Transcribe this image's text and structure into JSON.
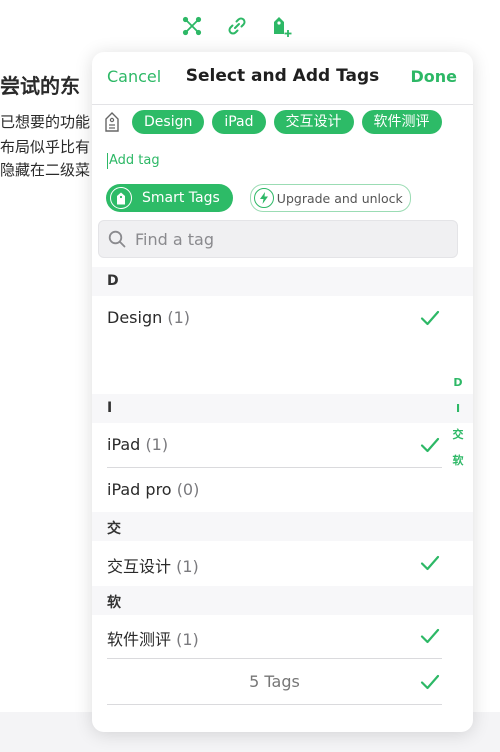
{
  "background_doc": {
    "heading": "尝试的东",
    "lines": [
      "已想要的功能",
      "布局似乎比有",
      "隐藏在二级菜"
    ]
  },
  "toolbar": {
    "icons": [
      "graph-icon",
      "link-icon",
      "add-tag-icon"
    ]
  },
  "header": {
    "cancel_label": "Cancel",
    "title": "Select and Add Tags",
    "done_label": "Done"
  },
  "selected_tags": [
    "Design",
    "iPad",
    "交互设计",
    "软件测评"
  ],
  "add_tag_placeholder": "Add tag",
  "smart_tags_label": "Smart Tags",
  "upgrade_label": "Upgrade and unlock",
  "search": {
    "placeholder": "Find a tag"
  },
  "sections": [
    {
      "letter": "D",
      "rows": [
        {
          "name": "Design",
          "count": "(1)",
          "checked": true
        }
      ]
    },
    {
      "letter": "I",
      "rows": [
        {
          "name": "iPad",
          "count": "(1)",
          "checked": true
        },
        {
          "name": "iPad pro",
          "count": "(0)",
          "checked": false
        }
      ]
    },
    {
      "letter": "交",
      "rows": [
        {
          "name": "交互设计",
          "count": "(1)",
          "checked": true
        }
      ]
    },
    {
      "letter": "软",
      "rows": [
        {
          "name": "软件测评",
          "count": "(1)",
          "checked": true
        }
      ]
    }
  ],
  "footer": {
    "label": "5 Tags",
    "checked": true
  },
  "index": [
    "D",
    "I",
    "交",
    "软"
  ],
  "colors": {
    "accent": "#2dbb67",
    "text": "#2a2a2a",
    "muted": "#7a7a7e"
  }
}
